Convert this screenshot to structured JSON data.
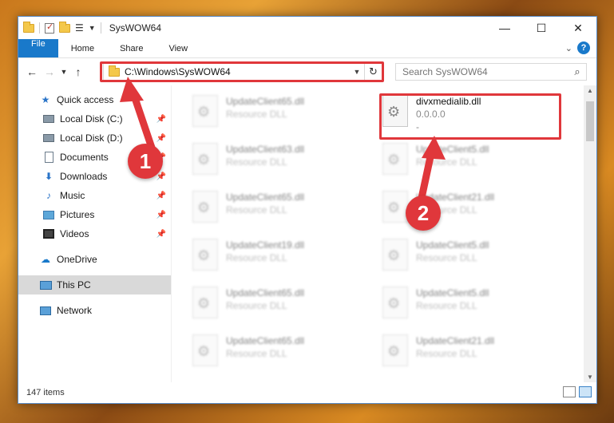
{
  "window": {
    "title": "SysWOW64",
    "controls": {
      "minimize": "—",
      "maximize": "☐",
      "close": "✕"
    }
  },
  "ribbon": {
    "tabs": [
      "File",
      "Home",
      "Share",
      "View"
    ]
  },
  "address": {
    "path": "C:\\Windows\\SysWOW64",
    "refresh_icon": "refresh-icon"
  },
  "search": {
    "placeholder": "Search SysWOW64"
  },
  "sidebar": {
    "items": [
      {
        "label": "Quick access",
        "icon": "star-icon",
        "pinned": false
      },
      {
        "label": "Local Disk (C:)",
        "icon": "disk-icon",
        "pinned": true
      },
      {
        "label": "Local Disk (D:)",
        "icon": "disk-icon",
        "pinned": true
      },
      {
        "label": "Documents",
        "icon": "documents-icon",
        "pinned": true
      },
      {
        "label": "Downloads",
        "icon": "downloads-icon",
        "pinned": true
      },
      {
        "label": "Music",
        "icon": "music-icon",
        "pinned": true
      },
      {
        "label": "Pictures",
        "icon": "pictures-icon",
        "pinned": true
      },
      {
        "label": "Videos",
        "icon": "videos-icon",
        "pinned": true
      },
      {
        "label": "OneDrive",
        "icon": "onedrive-icon",
        "pinned": false
      },
      {
        "label": "This PC",
        "icon": "this-pc-icon",
        "pinned": false,
        "selected": true
      },
      {
        "label": "Network",
        "icon": "network-icon",
        "pinned": false
      }
    ]
  },
  "files": [
    {
      "name": "UpdateClient65.dll",
      "type": "Resource DLL"
    },
    {
      "name": "divxmedialib.dll",
      "type": "0.0.0.0",
      "extra": "-"
    },
    {
      "name": "UpdateClient63.dll",
      "type": "Resource DLL"
    },
    {
      "name": "UpdateClient5.dll",
      "type": "Resource DLL"
    },
    {
      "name": "UpdateClient65.dll",
      "type": "Resource DLL"
    },
    {
      "name": "UpdateClient21.dll",
      "type": "Resource DLL"
    },
    {
      "name": "UpdateClient19.dll",
      "type": "Resource DLL"
    },
    {
      "name": "UpdateClient5.dll",
      "type": "Resource DLL"
    },
    {
      "name": "UpdateClient65.dll",
      "type": "Resource DLL"
    },
    {
      "name": "UpdateClient5.dll",
      "type": "Resource DLL"
    },
    {
      "name": "UpdateClient65.dll",
      "type": "Resource DLL"
    },
    {
      "name": "UpdateClient21.dll",
      "type": "Resource DLL"
    }
  ],
  "status": {
    "item_count": "147 items"
  },
  "annotations": {
    "step1": "1",
    "step2": "2",
    "color": "#e0373b"
  }
}
